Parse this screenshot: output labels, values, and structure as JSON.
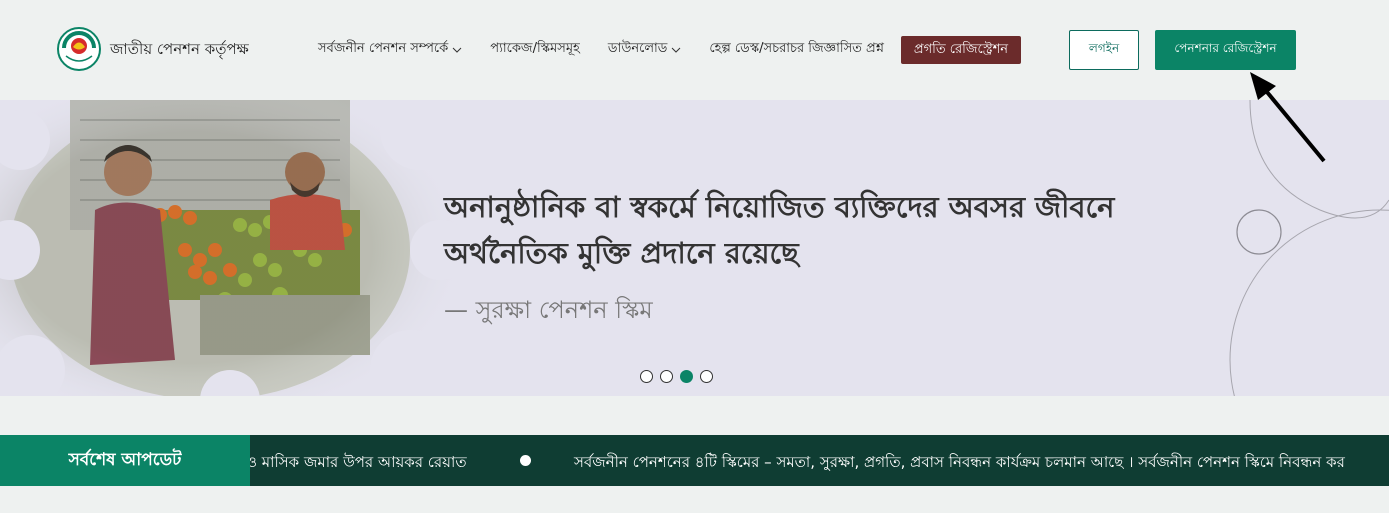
{
  "header": {
    "brand": "জাতীয় পেনশন কর্তৃপক্ষ",
    "nav": [
      {
        "label": "সর্বজনীন পেনশন সম্পর্কে",
        "dropdown": true
      },
      {
        "label": "প্যাকেজ/স্কিমসমূহ",
        "dropdown": false
      },
      {
        "label": "ডাউনলোড",
        "dropdown": true
      },
      {
        "label": "হেল্প ডেস্ক/সচরাচর জিজ্ঞাসিত প্রশ্ন",
        "dropdown": false
      }
    ],
    "pill_label": "প্রগতি রেজিস্ট্রেশন",
    "login_label": "লগইন",
    "register_label": "পেনশনার রেজিস্ট্রেশন"
  },
  "hero": {
    "title_line1": "অনানুষ্ঠানিক বা স্বকর্মে নিয়োজিত ব্যক্তিদের অবসর জীবনে",
    "title_line2": "অর্থনৈতিক মুক্তি প্রদানে রয়েছে",
    "subtitle": "— সুরক্ষা পেনশন স্কিম",
    "slides": 4,
    "active_slide": 3
  },
  "ticker": {
    "label": "সর্বশেষ আপডেট",
    "text_before": "ও মাসিক জমার উপর আয়কর রেয়াত",
    "text_after": "সর্বজনীন পেনশনের ৪টি স্কিমের – সমতা, সুরক্ষা, প্রগতি, প্রবাস নিবন্ধন কার্যক্রম চলমান আছে । সর্বজনীন পেনশন স্কিমে নিবন্ধন কর"
  },
  "colors": {
    "accent": "#0b8466",
    "pill": "#6b2b2b",
    "ticker_bg": "#0f3d33",
    "hero_bg": "#e4e3ee"
  }
}
